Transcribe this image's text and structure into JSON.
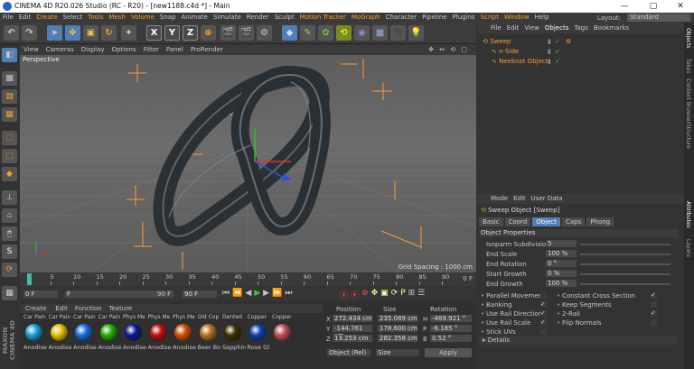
{
  "window": {
    "title": "CINEMA 4D R20.026 Studio (RC - R20) - [new1188.c4d *] - Main",
    "minimize": "—",
    "maximize": "▢",
    "close": "✕"
  },
  "menu": {
    "items": [
      "File",
      "Edit",
      "Create",
      "Select",
      "Tools",
      "Mesh",
      "Volume",
      "Snap",
      "Animate",
      "Simulate",
      "Render",
      "Sculpt",
      "Motion Tracker",
      "MoGraph",
      "Character",
      "Pipeline",
      "Plugins",
      "Script",
      "Window",
      "Help"
    ],
    "highlighted": [
      "Motion Tracker",
      "MoGraph",
      "Script",
      "Window",
      "Create",
      "Tools",
      "Mesh",
      "Volume"
    ],
    "layout_label": "Layout:",
    "layout_value": "Standard"
  },
  "toolbar": {
    "axes": [
      "X",
      "Y",
      "Z"
    ]
  },
  "view_menu": {
    "items": [
      "View",
      "Cameras",
      "Display",
      "Options",
      "Filter",
      "Panel",
      "ProRender"
    ],
    "camera_label": "Perspective",
    "grid_spacing": "Grid Spacing : 1000 cm"
  },
  "timeline": {
    "ticks": [
      "0",
      "5",
      "10",
      "15",
      "20",
      "25",
      "30",
      "35",
      "40",
      "45",
      "50",
      "55",
      "60",
      "65",
      "70",
      "75",
      "80",
      "85",
      "90"
    ],
    "end_label": "0 F"
  },
  "transport": {
    "start": "0 F",
    "current": "F",
    "end1": "90 F",
    "end2": "90 F"
  },
  "materials": {
    "menu": [
      "Create",
      "Edit",
      "Function",
      "Texture"
    ],
    "top_row": [
      "Car Pain",
      "Car Pain",
      "Car Pain",
      "Car Pain",
      "Phys Me",
      "Phys Me",
      "Phys Me",
      "Old Cop",
      "Dented",
      "Copper",
      "Copper"
    ],
    "names": [
      "Anodise",
      "Anodise",
      "Anodise",
      "Anodise",
      "Anodise",
      "Anodise",
      "Anodise",
      "Beer Bo",
      "Sapphire",
      "Rose Gl"
    ],
    "colors": [
      "#18a0d8",
      "#e8c000",
      "#1a6de0",
      "#22b000",
      "#0c1890",
      "#c01010",
      "#d05000",
      "#b87020",
      "#3e3000",
      "#0b3fb0",
      "#c05050"
    ]
  },
  "coordinates": {
    "headers": [
      "Position",
      "Size",
      "Rotation"
    ],
    "rows": [
      {
        "axis": "X",
        "pos": "272.434 cm",
        "size": "235.089 cm",
        "rot_axis": "H",
        "rot": "-469.921 °"
      },
      {
        "axis": "Y",
        "pos": "-144.761 cm",
        "size": "178.600 cm",
        "rot_axis": "P",
        "rot": "-6.185 °"
      },
      {
        "axis": "Z",
        "pos": "13.253 cm",
        "size": "282.358 cm",
        "rot_axis": "B",
        "rot": "0.52 °"
      }
    ],
    "mode": "Object (Rel)",
    "size_mode": "Size",
    "apply": "Apply"
  },
  "objects": {
    "menu": [
      "File",
      "Edit",
      "View",
      "Objects",
      "Tags",
      "Bookmarks"
    ],
    "items": [
      {
        "name": "Sweep",
        "color": "#ff9a2e",
        "indent": 0
      },
      {
        "name": "n-Side",
        "color": "#ff9a2e",
        "indent": 1
      },
      {
        "name": "Neeknot Object",
        "color": "#ff9a2e",
        "indent": 1
      }
    ]
  },
  "attributes": {
    "menu": [
      "Mode",
      "Edit",
      "User Data"
    ],
    "object_title": "Sweep Object [Sweep]",
    "tabs": [
      "Basic",
      "Coord",
      "Object",
      "Caps",
      "Phong"
    ],
    "active_tab": "Object",
    "section": "Object Properties",
    "fields": [
      {
        "label": "Isoparm Subdivision",
        "value": "5"
      },
      {
        "label": "End Scale",
        "value": "100 %"
      },
      {
        "label": "End Rotation",
        "value": "0 °"
      },
      {
        "label": "Start Growth",
        "value": "0 %"
      },
      {
        "label": "End Growth",
        "value": "100 %"
      }
    ],
    "checks_left": [
      {
        "label": "Parallel Movement",
        "checked": false
      },
      {
        "label": "Banking",
        "checked": true
      },
      {
        "label": "Use Rail Direction",
        "checked": true
      },
      {
        "label": "Use Rail Scale",
        "checked": true
      },
      {
        "label": "Stick UVs",
        "checked": false
      }
    ],
    "checks_right": [
      {
        "label": "Constant Cross Section",
        "checked": true
      },
      {
        "label": "Keep Segments",
        "checked": false
      },
      {
        "label": "2-Rail",
        "checked": true
      },
      {
        "label": "Flip Normals",
        "checked": false
      }
    ],
    "details": "Details"
  },
  "side_tabs": [
    "Objects",
    "Takes",
    "Content Browser",
    "Structure",
    "Attributes",
    "Layers"
  ],
  "brand": {
    "line1": "MAXON",
    "line2": "CINEMA 4D"
  },
  "colors": {
    "accent": "#ff9a2e",
    "background": "#313131",
    "active_tab": "#4f7fb3"
  }
}
